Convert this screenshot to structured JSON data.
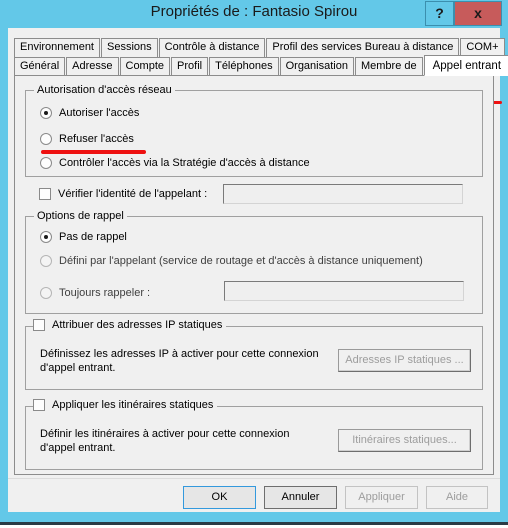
{
  "window": {
    "title": "Propriétés de : Fantasio Spirou",
    "help_button": "?",
    "close_button": "x",
    "frame_color": "#63c8e8",
    "close_color": "#c75b5b",
    "annotation_color": "#ee1111"
  },
  "tabs": {
    "row_top": [
      {
        "label": "Environnement"
      },
      {
        "label": "Sessions"
      },
      {
        "label": "Contrôle à distance"
      },
      {
        "label": "Profil des services Bureau à distance"
      },
      {
        "label": "COM+"
      }
    ],
    "row_bottom": [
      {
        "label": "Général"
      },
      {
        "label": "Adresse"
      },
      {
        "label": "Compte"
      },
      {
        "label": "Profil"
      },
      {
        "label": "Téléphones"
      },
      {
        "label": "Organisation"
      },
      {
        "label": "Membre de"
      },
      {
        "label": "Appel entrant"
      }
    ],
    "selected": "Appel entrant"
  },
  "network_access": {
    "legend": "Autorisation d'accès réseau",
    "options": [
      {
        "label": "Autoriser l'accès",
        "checked": true
      },
      {
        "label": "Refuser l'accès",
        "checked": false
      },
      {
        "label": "Contrôler l'accès via la Stratégie d'accès à distance",
        "checked": false
      }
    ]
  },
  "verify_caller": {
    "label": "Vérifier l'identité de l'appelant :",
    "checked": false,
    "value": "",
    "enabled": false
  },
  "callback": {
    "legend": "Options de rappel",
    "options": [
      {
        "label": "Pas de rappel",
        "checked": true
      },
      {
        "label": "Défini par l'appelant (service de routage et d'accès à distance uniquement)",
        "checked": false
      },
      {
        "label": "Toujours rappeler :",
        "checked": false
      }
    ],
    "always_callback_value": "",
    "always_callback_enabled": false
  },
  "static_ip": {
    "checkbox_label": "Attribuer des adresses IP statiques",
    "checked": false,
    "description_line1": "Définissez les adresses IP à activer pour cette connexion",
    "description_line2": "d'appel entrant.",
    "button_label": "Adresses IP statiques ...",
    "button_enabled": false
  },
  "static_routes": {
    "checkbox_label": "Appliquer les itinéraires statiques",
    "checked": false,
    "description_line1": "Définir les itinéraires à activer pour cette connexion",
    "description_line2": "d'appel entrant.",
    "button_label": "Itinéraires statiques...",
    "button_enabled": false
  },
  "footer_buttons": [
    {
      "label": "OK",
      "enabled": true,
      "style": "default"
    },
    {
      "label": "Annuler",
      "enabled": true,
      "style": "strong"
    },
    {
      "label": "Appliquer",
      "enabled": false,
      "style": "plain"
    },
    {
      "label": "Aide",
      "enabled": false,
      "style": "plain"
    }
  ]
}
